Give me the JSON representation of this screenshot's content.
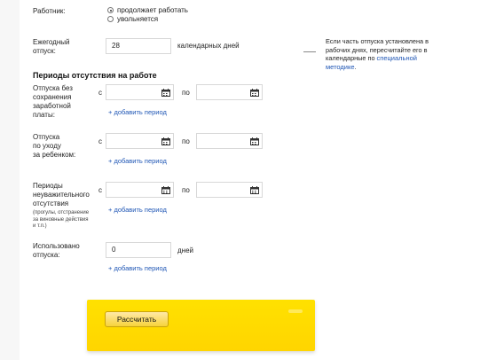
{
  "worker": {
    "label": "Работник:",
    "options": [
      {
        "label": "продолжает работать",
        "checked": true
      },
      {
        "label": "увольняется",
        "checked": false
      }
    ]
  },
  "annual": {
    "label_line1": "Ежегодный",
    "label_line2": "отпуск:",
    "value": "28",
    "unit": "календарных дней"
  },
  "note": {
    "line1": "Если часть отпуска установлена в",
    "line2": "рабочих днях, пересчитайте его в",
    "line3_prefix": "календарные по ",
    "line3_link": "специальной",
    "line4_link": "методике",
    "line4_suffix": "."
  },
  "section_title": "Периоды отсутствия на работе",
  "periods": [
    {
      "label_lines": [
        "Отпуска без",
        "сохранения",
        "заработной",
        "платы:"
      ],
      "from_label": "с",
      "to_label": "по",
      "add_link": "+ добавить период"
    },
    {
      "label_lines": [
        "Отпуска",
        "по уходу",
        "за ребенком:"
      ],
      "from_label": "с",
      "to_label": "по",
      "add_link": "+ добавить период"
    },
    {
      "label_lines": [
        "Периоды",
        "неуважительного",
        "отсутствия"
      ],
      "sub_lines": [
        "(прогулы, отстранение",
        "за виновные действия",
        "и т.п.)"
      ],
      "from_label": "с",
      "to_label": "по",
      "add_link": "+ добавить период"
    }
  ],
  "used": {
    "label_line1": "Использовано",
    "label_line2": "отпуска:",
    "value": "0",
    "unit": "дней",
    "add_link": "+ добавить период"
  },
  "calculate_label": "Рассчитать"
}
